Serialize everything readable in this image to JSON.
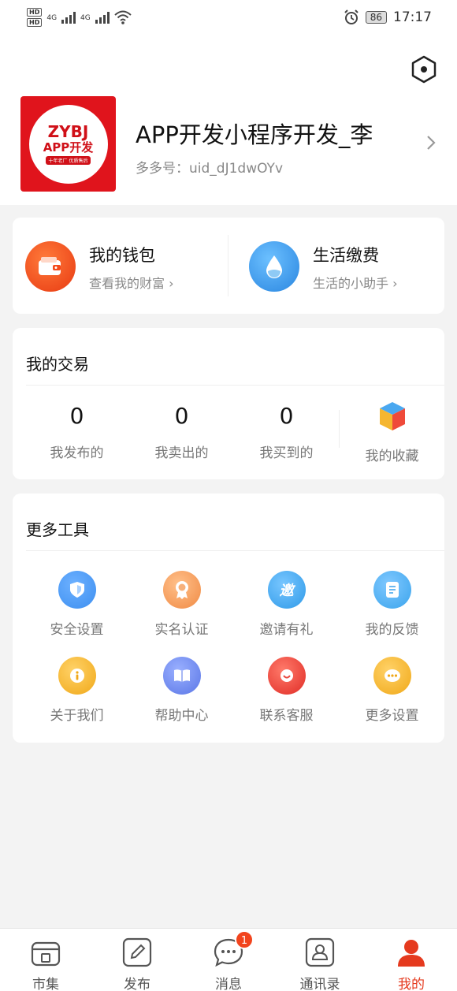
{
  "status_bar": {
    "time": "17:17",
    "battery": "86",
    "network": "4G"
  },
  "profile": {
    "name": "APP开发小程序开发_李",
    "id_label": "多多号：",
    "id_value": "uid_dJ1dwOYv",
    "logo": {
      "mark": "ZYBJ",
      "text": "APP开发",
      "sub": "十年老厂 优质售后",
      "color": "#e0141c"
    }
  },
  "wallet": {
    "title": "我的钱包",
    "subtitle": "查看我的财富",
    "color": "#f44a1a"
  },
  "bills": {
    "title": "生活缴费",
    "subtitle": "生活的小助手",
    "color": "#3a9be8"
  },
  "trades": {
    "title": "我的交易",
    "items": [
      {
        "value": "0",
        "label": "我发布的"
      },
      {
        "value": "0",
        "label": "我卖出的"
      },
      {
        "value": "0",
        "label": "我买到的"
      }
    ],
    "favorites_label": "我的收藏"
  },
  "tools": {
    "title": "更多工具",
    "items": [
      {
        "label": "安全设置",
        "icon": "shield-icon",
        "color": "#3d8ff0"
      },
      {
        "label": "实名认证",
        "icon": "certificate-icon",
        "color": "#f59a54"
      },
      {
        "label": "邀请有礼",
        "icon": "invite-icon",
        "glyph": "邀",
        "color": "#3aa8f0"
      },
      {
        "label": "我的反馈",
        "icon": "feedback-icon",
        "color": "#47aef2"
      },
      {
        "label": "关于我们",
        "icon": "info-icon",
        "color": "#f5b630"
      },
      {
        "label": "帮助中心",
        "icon": "book-icon",
        "color": "#6c86ee"
      },
      {
        "label": "联系客服",
        "icon": "service-icon",
        "color": "#ee3f38"
      },
      {
        "label": "更多设置",
        "icon": "more-icon",
        "color": "#f5b630"
      }
    ]
  },
  "tab_bar": {
    "items": [
      {
        "label": "市集",
        "icon": "market-icon"
      },
      {
        "label": "发布",
        "icon": "edit-icon"
      },
      {
        "label": "消息",
        "icon": "message-icon",
        "badge": "1"
      },
      {
        "label": "通讯录",
        "icon": "contacts-icon"
      },
      {
        "label": "我的",
        "icon": "profile-icon",
        "active": true
      }
    ],
    "active_color": "#e53a1e"
  }
}
